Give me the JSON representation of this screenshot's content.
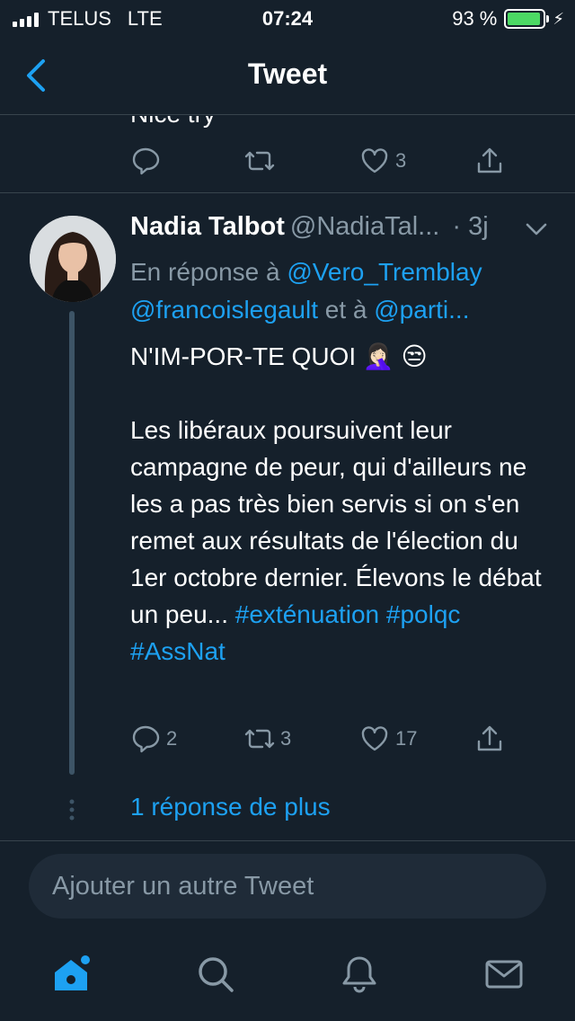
{
  "status_bar": {
    "carrier": "TELUS",
    "network": "LTE",
    "time": "07:24",
    "battery_text": "93 %",
    "battery_level": 0.93,
    "charging_icon": "bolt-icon"
  },
  "nav": {
    "title": "Tweet",
    "back_icon": "chevron-left-icon"
  },
  "prev_tweet": {
    "text_fragment": "Nice try",
    "reply_count": "",
    "retweet_count": "",
    "like_count": "3"
  },
  "tweet": {
    "author_name": "Nadia Talbot",
    "author_handle": "@NadiaTal...",
    "time_ago": "· 3j",
    "reply_prefix": "En réponse à ",
    "reply_mention_1": "@Vero_Tremblay",
    "reply_mention_2": "@francoislegault",
    "reply_connector": " et à ",
    "reply_mention_3": "@parti...",
    "line1": "N'IM-POR-TE QUOI 🤦🏻‍♀️ 😒",
    "paragraph": "Les libéraux poursuivent leur campagne de peur, qui d'ailleurs ne les a pas très bien servis si on s'en remet aux résultats de l'élection du 1er octobre dernier. Élevons le débat un peu... ",
    "hashtag_1": "#exténuation",
    "hashtag_2": "#polqc",
    "hashtag_3": "#AssNat",
    "reply_count": "2",
    "retweet_count": "3",
    "like_count": "17",
    "more_replies": "1 réponse de plus"
  },
  "compose": {
    "placeholder": "Ajouter un autre Tweet"
  },
  "colors": {
    "background": "#15202b",
    "accent": "#1da1f2",
    "muted": "#8899a6",
    "divider": "#38444d"
  },
  "tabs": [
    "home-icon",
    "search-icon",
    "notifications-bell-icon",
    "messages-envelope-icon"
  ]
}
